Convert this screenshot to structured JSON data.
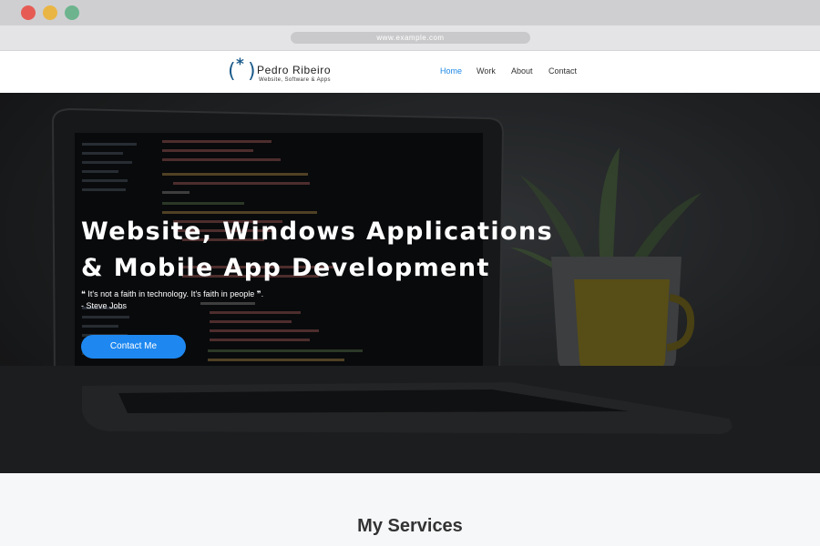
{
  "browser": {
    "url": "www.example.com",
    "controls": {
      "close_color": "#e65c55",
      "minimize_color": "#e9b544",
      "zoom_color": "#6db48e"
    }
  },
  "site": {
    "logo": {
      "mark_icon": "paren-star-logo-icon",
      "name": "Pedro Ribeiro",
      "tagline": "Website, Software & Apps",
      "color": "#1a5a8a"
    },
    "nav": [
      {
        "label": "Home",
        "active": true
      },
      {
        "label": "Work",
        "active": false
      },
      {
        "label": "About",
        "active": false
      },
      {
        "label": "Contact",
        "active": false
      }
    ],
    "accent": "#1e88e5"
  },
  "hero": {
    "title_line1": "Website, Windows Applications",
    "title_line2": "& Mobile App Development",
    "quote": "❝ It's not a faith in technology. It's faith in people ❞.",
    "quote_author": "- Steve Jobs",
    "cta_label": "Contact Me",
    "cta_color": "#1e88f0",
    "background_icon": "laptop-with-code-photo"
  },
  "services": {
    "title": "My Services"
  }
}
